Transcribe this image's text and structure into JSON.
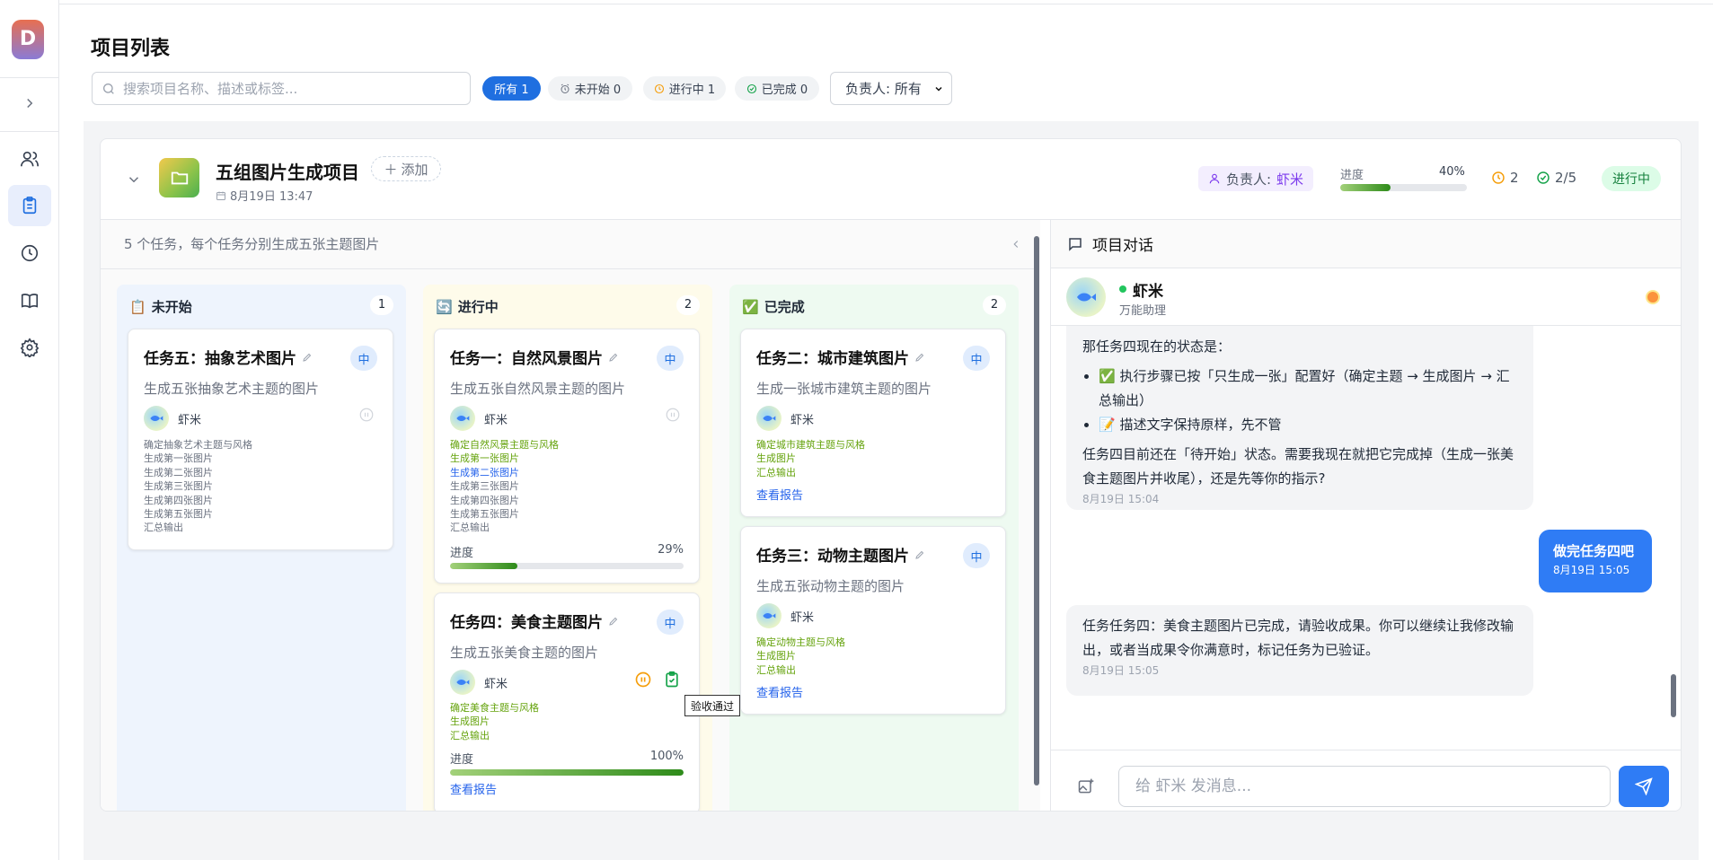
{
  "sidebar": {
    "logo_letter": "D",
    "items": [
      {
        "icon": "users-icon"
      },
      {
        "icon": "clipboard-icon",
        "active": true
      },
      {
        "icon": "clock-icon"
      },
      {
        "icon": "book-icon"
      },
      {
        "icon": "gear-icon"
      }
    ]
  },
  "header": {
    "title": "项目列表",
    "search_placeholder": "搜索项目名称、描述或标签...",
    "filters": [
      {
        "label": "所有 1",
        "active": true
      },
      {
        "label": "未开始 0",
        "icon": "alarm-icon"
      },
      {
        "label": "进行中 1",
        "icon": "clock-icon"
      },
      {
        "label": "已完成 0",
        "icon": "check-circle-icon"
      }
    ],
    "owner_filter": "负责人: 所有"
  },
  "project": {
    "name": "五组图片生成项目",
    "add_label": "添加",
    "date": "8月19日 13:47",
    "owner_label": "负责人:",
    "owner_name": "虾米",
    "progress_label": "进度",
    "progress_value": "40%",
    "progress_fraction": 0.4,
    "in_progress_count": "2",
    "done_count": "2/5",
    "status": "进行中",
    "description": "5 个任务，每个任务分别生成五张主题图片"
  },
  "columns": [
    {
      "name": "未开始",
      "count": "1",
      "color": "#eef4fd",
      "emoji": "📋",
      "cards": [
        {
          "title": "任务五：抽象艺术图片",
          "priority": "中",
          "desc": "生成五张抽象艺术主题的图片",
          "assignee": "虾米",
          "steps": [
            {
              "text": "确定抽象艺术主题与风格",
              "state": "todo"
            },
            {
              "text": "生成第一张图片",
              "state": "todo"
            },
            {
              "text": "生成第二张图片",
              "state": "todo"
            },
            {
              "text": "生成第三张图片",
              "state": "todo"
            },
            {
              "text": "生成第四张图片",
              "state": "todo"
            },
            {
              "text": "生成第五张图片",
              "state": "todo"
            },
            {
              "text": "汇总输出",
              "state": "todo"
            }
          ]
        }
      ]
    },
    {
      "name": "进行中",
      "count": "2",
      "color": "#fefbea",
      "emoji": "🔄",
      "cards": [
        {
          "title": "任务一：自然风景图片",
          "priority": "中",
          "desc": "生成五张自然风景主题的图片",
          "assignee": "虾米",
          "steps": [
            {
              "text": "确定自然风景主题与风格",
              "state": "done"
            },
            {
              "text": "生成第一张图片",
              "state": "done"
            },
            {
              "text": "生成第二张图片",
              "state": "current"
            },
            {
              "text": "生成第三张图片",
              "state": "todo"
            },
            {
              "text": "生成第四张图片",
              "state": "todo"
            },
            {
              "text": "生成第五张图片",
              "state": "todo"
            },
            {
              "text": "汇总输出",
              "state": "todo"
            }
          ],
          "progress_label": "进度",
          "progress": "29%",
          "progress_fraction": 0.29
        },
        {
          "title": "任务四：美食主题图片",
          "priority": "中",
          "desc": "生成五张美食主题的图片",
          "assignee": "虾米",
          "steps": [
            {
              "text": "确定美食主题与风格",
              "state": "done"
            },
            {
              "text": "生成图片",
              "state": "done"
            },
            {
              "text": "汇总输出",
              "state": "done"
            }
          ],
          "progress_label": "进度",
          "progress": "100%",
          "progress_fraction": 1.0,
          "report_link": "查看报告",
          "tooltip": "验收通过"
        }
      ]
    },
    {
      "name": "已完成",
      "count": "2",
      "color": "#eefaf1",
      "emoji": "✅",
      "cards": [
        {
          "title": "任务二：城市建筑图片",
          "priority": "中",
          "desc": "生成一张城市建筑主题的图片",
          "assignee": "虾米",
          "steps": [
            {
              "text": "确定城市建筑主题与风格",
              "state": "done"
            },
            {
              "text": "生成图片",
              "state": "done"
            },
            {
              "text": "汇总输出",
              "state": "done"
            }
          ],
          "report_link": "查看报告"
        },
        {
          "title": "任务三：动物主题图片",
          "priority": "中",
          "desc": "生成五张动物主题的图片",
          "assignee": "虾米",
          "steps": [
            {
              "text": "确定动物主题与风格",
              "state": "done"
            },
            {
              "text": "生成图片",
              "state": "done"
            },
            {
              "text": "汇总输出",
              "state": "done"
            }
          ],
          "report_link": "查看报告"
        }
      ]
    }
  ],
  "chat": {
    "title": "项目对话",
    "agent_name": "虾米",
    "agent_role": "万能助理",
    "messages": [
      {
        "from": "agent",
        "intro": "那任务四现在的状态是：",
        "bullets": [
          "✅ 执行步骤已按「只生成一张」配置好（确定主题 → 生成图片 → 汇总输出）",
          "📝 描述文字保持原样，先不管"
        ],
        "text": "任务四目前还在「待开始」状态。需要我现在就把它完成掉（生成一张美食主题图片并收尾），还是先等你的指示?",
        "time": "8月19日 15:04"
      },
      {
        "from": "user",
        "text": "做完任务四吧",
        "time": "8月19日 15:05"
      },
      {
        "from": "agent",
        "text": "任务任务四：美食主题图片已完成，请验收成果。你可以继续让我修改输出，或者当成果令你满意时，标记任务为已验证。",
        "time": "8月19日 15:05"
      }
    ],
    "input_placeholder": "给 虾米 发消息..."
  }
}
